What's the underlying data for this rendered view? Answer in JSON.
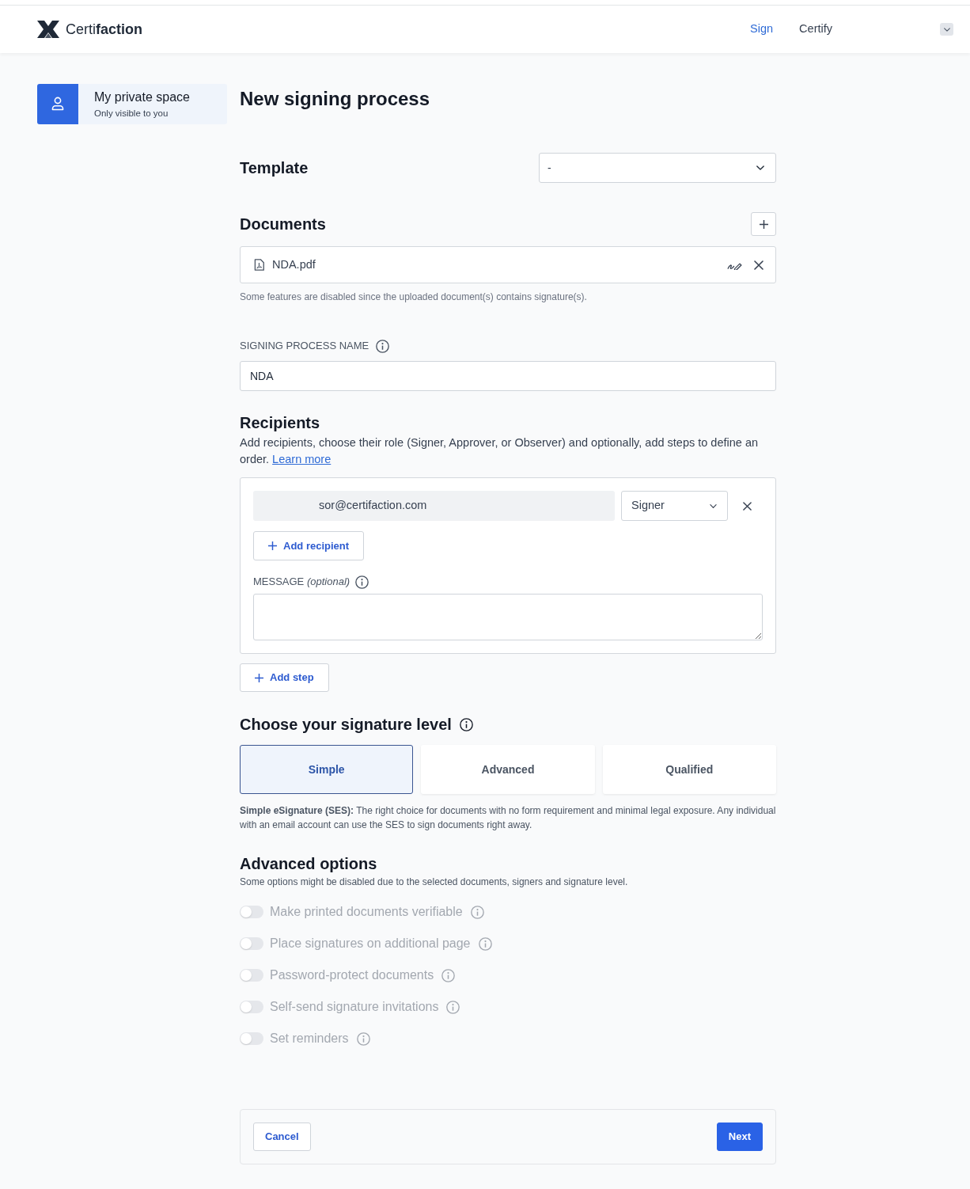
{
  "header": {
    "logo_text": "Certi**faction**",
    "nav": [
      {
        "label": "Sign",
        "selected": true
      },
      {
        "label": "Certify",
        "selected": false
      }
    ]
  },
  "sidebar": {
    "items": [
      {
        "title": "My private space",
        "subtitle": "Only visible to you",
        "selected": true
      }
    ]
  },
  "page_title": "New signing process",
  "template": {
    "label": "Template",
    "value": "-"
  },
  "documents": {
    "label": "Documents",
    "files": [
      {
        "name": "NDA.pdf"
      }
    ],
    "note": "Some features are disabled since the uploaded document(s) contains signature(s)."
  },
  "process_name": {
    "label": "SIGNING PROCESS NAME",
    "value": "NDA"
  },
  "recipients": {
    "title": "Recipients",
    "description": "Add recipients, choose their role (Signer, Approver, or Observer) and optionally, add steps to define an order.",
    "link": "Learn more",
    "steps": [
      {
        "recipients": [
          {
            "email": "sor@certifaction.com",
            "role": "Signer"
          }
        ],
        "add_recipient": "Add recipient",
        "message_label": "MESSAGE *(optional)*"
      }
    ],
    "add_step": "Add step"
  },
  "signature_level": {
    "title": "Choose your signature level",
    "options": [
      {
        "label": "Simple",
        "selected": true
      },
      {
        "label": "Advanced",
        "selected": false
      },
      {
        "label": "Qualified",
        "selected": false
      }
    ],
    "description": "**Simple eSignature (SES):** The right choice for documents with no form requirement and minimal legal exposure. Any individual with an email account can use the SES to sign documents right away."
  },
  "advanced_options": {
    "title": "Advanced options",
    "subtitle": "Some options might be disabled due to the selected documents, signers and signature level.",
    "options": [
      {
        "label": "Make printed documents verifiable",
        "on": false,
        "disabled": true
      },
      {
        "label": "Place signatures on additional page",
        "on": false,
        "disabled": true
      },
      {
        "label": "Password-protect documents",
        "on": false,
        "disabled": true
      },
      {
        "label": "Self-send signature invitations",
        "on": false,
        "disabled": true
      },
      {
        "label": "Set reminders",
        "on": false,
        "disabled": true
      }
    ]
  },
  "footer": {
    "buttons": [
      {
        "label": "Cancel",
        "kind": "secondary"
      },
      {
        "label": "Next",
        "kind": "primary"
      }
    ]
  }
}
